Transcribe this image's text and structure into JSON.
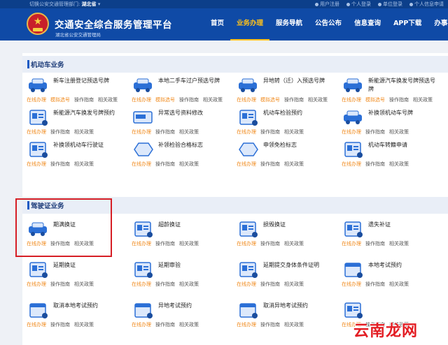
{
  "topbar": {
    "dept_label": "切换公安交通管理部门:",
    "dept_value": "湖北省",
    "links": [
      "用户注册",
      "个人登录",
      "单位登录",
      "个人信息申请"
    ]
  },
  "header": {
    "title": "交通安全综合服务管理平台",
    "subtitle": "湖北省公安交通管理局",
    "nav": [
      "首页",
      "业务办理",
      "服务导航",
      "公告公布",
      "信息查询",
      "APP下载",
      "办事指南"
    ],
    "active_nav": "业务办理"
  },
  "colors": {
    "header_bg": "#0f4aa6",
    "nav_active": "#ffc21a",
    "link_orange": "#f08a1c",
    "highlight_red": "#d61f26"
  },
  "sections": [
    {
      "title": "机动车业务",
      "items": [
        {
          "name": "新车注册登记预选号牌",
          "actions": [
            "在线办理",
            "模拟选号",
            "操作指南",
            "相关政策"
          ],
          "icon": "car-plate-icon"
        },
        {
          "name": "本地二手车过户预选号牌",
          "actions": [
            "在线办理",
            "模拟选号",
            "操作指南",
            "相关政策"
          ],
          "icon": "car-transfer-icon"
        },
        {
          "name": "异地转（迁）入预选号牌",
          "actions": [
            "在线办理",
            "模拟选号",
            "操作指南",
            "相关政策"
          ],
          "icon": "car-move-in-icon"
        },
        {
          "name": "新能源汽车换发号牌预选号牌",
          "actions": [
            "在线办理",
            "模拟选号",
            "操作指南",
            "相关政策"
          ],
          "icon": "new-energy-car-icon"
        },
        {
          "name": "新能源汽车换发号牌预约",
          "actions": [
            "在线办理",
            "操作指南",
            "相关政策"
          ],
          "icon": "plate-document-icon"
        },
        {
          "name": "异常选号资料修改",
          "actions": [
            "在线办理",
            "操作指南",
            "相关政策"
          ],
          "icon": "number-edit-icon"
        },
        {
          "name": "机动车检验预约",
          "actions": [
            "在线办理",
            "操作指南",
            "相关政策"
          ],
          "icon": "inspection-doc-icon"
        },
        {
          "name": "补换领机动车号牌",
          "actions": [
            "在线办理",
            "操作指南",
            "相关政策"
          ],
          "icon": "car-plate-replace-icon"
        },
        {
          "name": "补换领机动车行驶证",
          "actions": [
            "在线办理",
            "操作指南",
            "相关政策"
          ],
          "icon": "vehicle-license-icon"
        },
        {
          "name": "补领检验合格标志",
          "actions": [
            "在线办理",
            "操作指南",
            "相关政策"
          ],
          "icon": "inspection-badge-icon"
        },
        {
          "name": "申领免检标志",
          "actions": [
            "在线办理",
            "操作指南",
            "相关政策"
          ],
          "icon": "exempt-badge-icon"
        },
        {
          "name": "机动车转籍申请",
          "actions": [
            "在线办理",
            "操作指南",
            "相关政策"
          ],
          "icon": "transfer-registry-icon"
        }
      ]
    },
    {
      "title": "驾驶证业务",
      "items": [
        {
          "name": "期满换证",
          "actions": [
            "在线办理",
            "操作指南",
            "相关政策"
          ],
          "icon": "license-card-icon"
        },
        {
          "name": "超龄换证",
          "actions": [
            "在线办理",
            "操作指南",
            "相关政策"
          ],
          "icon": "license-age-icon"
        },
        {
          "name": "损毁换证",
          "actions": [
            "在线办理",
            "操作指南",
            "相关政策"
          ],
          "icon": "license-damaged-icon"
        },
        {
          "name": "遗失补证",
          "actions": [
            "在线办理",
            "操作指南",
            "相关政策"
          ],
          "icon": "license-lost-icon"
        },
        {
          "name": "延期换证",
          "actions": [
            "在线办理",
            "操作指南",
            "相关政策"
          ],
          "icon": "license-extend-icon"
        },
        {
          "name": "延期审验",
          "actions": [
            "在线办理",
            "操作指南",
            "相关政策"
          ],
          "icon": "review-extend-icon"
        },
        {
          "name": "延期提交身体条件证明",
          "actions": [
            "在线办理",
            "操作指南",
            "相关政策"
          ],
          "icon": "health-cert-icon"
        },
        {
          "name": "本地考试预约",
          "actions": [
            "在线办理",
            "操作指南",
            "相关政策"
          ],
          "icon": "exam-booking-icon"
        },
        {
          "name": "取消本地考试预约",
          "actions": [
            "在线办理",
            "操作指南",
            "相关政策"
          ],
          "icon": "cancel-exam-calendar-icon"
        },
        {
          "name": "异地考试预约",
          "actions": [
            "在线办理",
            "操作指南",
            "相关政策"
          ],
          "icon": "remote-exam-icon"
        },
        {
          "name": "取消异地考试预约",
          "actions": [
            "在线办理",
            "操作指南",
            "相关政策"
          ],
          "icon": "cancel-remote-exam-icon"
        },
        {
          "name": "",
          "actions": [
            "在线办理",
            "操作指南",
            "相关政策"
          ],
          "icon": "chart-doc-icon"
        }
      ]
    }
  ],
  "watermark": {
    "text": "云南龙网"
  }
}
